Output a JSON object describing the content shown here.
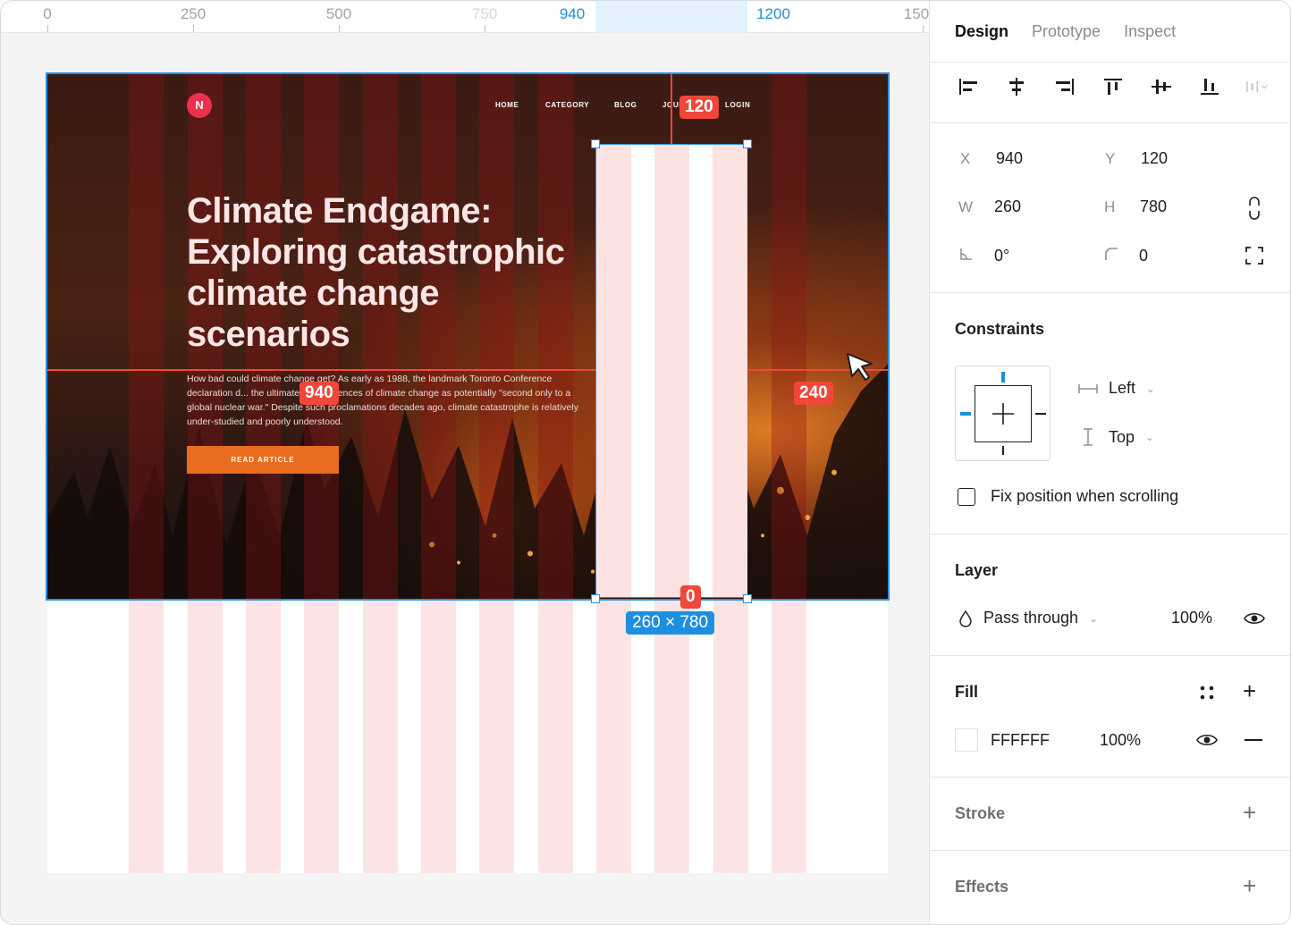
{
  "ruler": {
    "ticks": [
      "0",
      "250",
      "500",
      "750",
      "940",
      "1200",
      "150"
    ]
  },
  "artboard": {
    "logo_letter": "N",
    "nav": [
      "HOME",
      "CATEGORY",
      "BLOG",
      "JOUR",
      "LOGIN"
    ],
    "hero_title": "Climate Endgame: Exploring catastrophic climate change scenarios",
    "hero_body": "How bad could climate change get? As early as 1988, the landmark Toronto Conference declaration d... the ultimate consequences of climate change as potentially \"second only to a global nuclear war.\" Despite such proclamations decades ago, climate catastrophe is relatively under-studied and poorly understood.",
    "cta": "READ ARTICLE"
  },
  "measure": {
    "top_gap": "120",
    "left_gap": "940",
    "right_gap": "240",
    "bottom_gap": "0",
    "size": "260 × 780"
  },
  "panel": {
    "tabs": [
      "Design",
      "Prototype",
      "Inspect"
    ],
    "x_label": "X",
    "x_value": "940",
    "y_label": "Y",
    "y_value": "120",
    "w_label": "W",
    "w_value": "260",
    "h_label": "H",
    "h_value": "780",
    "rotation": "0°",
    "radius": "0",
    "constraints_title": "Constraints",
    "horizontal_constraint": "Left",
    "vertical_constraint": "Top",
    "fix_position_label": "Fix position when scrolling",
    "layer_title": "Layer",
    "blend_mode": "Pass through",
    "layer_opacity": "100%",
    "fill_title": "Fill",
    "fill_hex": "FFFFFF",
    "fill_opacity": "100%",
    "stroke_title": "Stroke",
    "effects_title": "Effects"
  },
  "colors": {
    "selection_blue": "#2b8fe6",
    "measure_red": "#f0473a",
    "grid_pink": "#fde4e4",
    "cta_orange": "#ea6c1f",
    "logo_red": "#ee2f4d"
  }
}
